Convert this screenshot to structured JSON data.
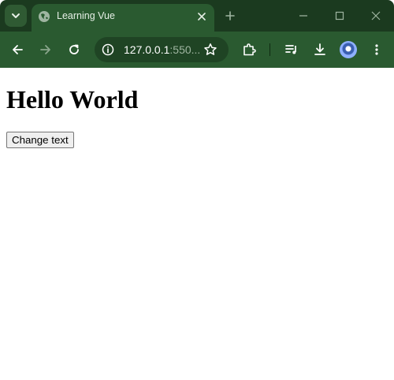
{
  "browser": {
    "tab": {
      "title": "Learning Vue"
    },
    "omnibox": {
      "host": "127.0.0.1",
      "rest": ":550..."
    },
    "icons": {
      "tab_search": "chevron-down-icon",
      "favicon": "globe-icon",
      "close": "close-icon",
      "new_tab": "plus-icon",
      "minimize": "minimize-icon",
      "maximize": "maximize-icon",
      "window_close": "window-close-icon",
      "back": "back-arrow-icon",
      "forward": "forward-arrow-icon",
      "reload": "reload-icon",
      "site_info": "info-icon",
      "bookmark": "star-icon",
      "extensions": "puzzle-icon",
      "media": "media-queue-icon",
      "download": "download-icon",
      "profile": "avatar",
      "menu": "kebab-menu-icon"
    },
    "colors": {
      "frame": "#1b3a1f",
      "toolbar": "#2a5a30",
      "omnibox": "#1f4424"
    }
  },
  "page": {
    "heading": "Hello World",
    "button_label": "Change text"
  }
}
